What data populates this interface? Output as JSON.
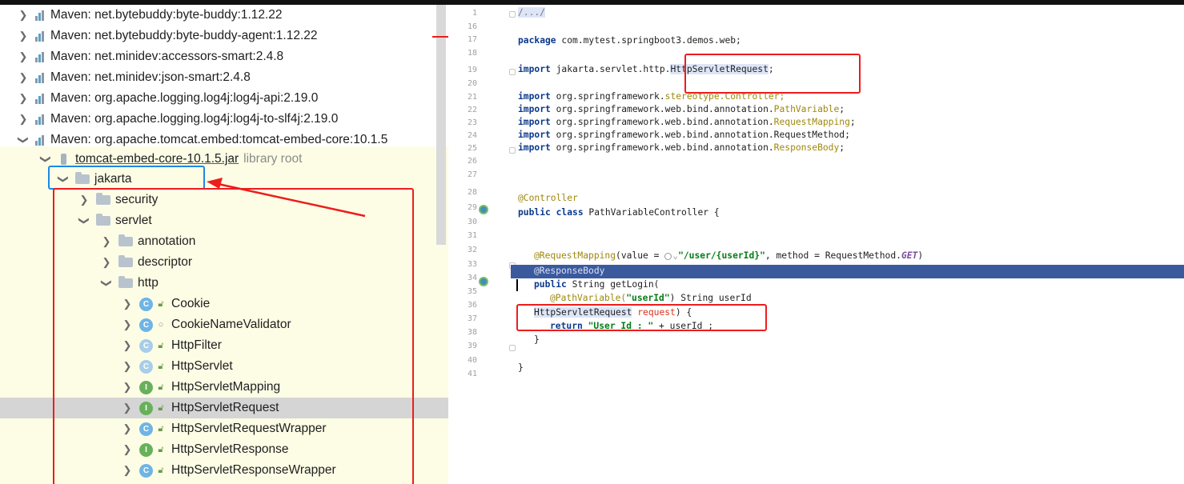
{
  "tree": {
    "libraries": [
      {
        "label": "Maven: net.bytebuddy:byte-buddy:1.12.22"
      },
      {
        "label": "Maven: net.bytebuddy:byte-buddy-agent:1.12.22"
      },
      {
        "label": "Maven: net.minidev:accessors-smart:2.4.8"
      },
      {
        "label": "Maven: net.minidev:json-smart:2.4.8"
      },
      {
        "label": "Maven: org.apache.logging.log4j:log4j-api:2.19.0"
      },
      {
        "label": "Maven: org.apache.logging.log4j:log4j-to-slf4j:2.19.0"
      },
      {
        "label": "Maven: org.apache.tomcat.embed:tomcat-embed-core:10.1.5"
      }
    ],
    "jar": {
      "label": "tomcat-embed-core-10.1.5.jar",
      "suffix": "library root"
    },
    "folders": {
      "jakarta": "jakarta",
      "security": "security",
      "servlet": "servlet",
      "annotation": "annotation",
      "descriptor": "descriptor",
      "http": "http"
    },
    "classes": [
      {
        "label": "Cookie",
        "badge": "C"
      },
      {
        "label": "CookieNameValidator",
        "badge": "C"
      },
      {
        "label": "HttpFilter",
        "badge": "C"
      },
      {
        "label": "HttpServlet",
        "badge": "C"
      },
      {
        "label": "HttpServletMapping",
        "badge": "I"
      },
      {
        "label": "HttpServletRequest",
        "badge": "I"
      },
      {
        "label": "HttpServletRequestWrapper",
        "badge": "C"
      },
      {
        "label": "HttpServletResponse",
        "badge": "I"
      },
      {
        "label": "HttpServletResponseWrapper",
        "badge": "C"
      }
    ]
  },
  "editor": {
    "line_numbers": [
      "1",
      "16",
      "17",
      "18",
      "19",
      "20",
      "21",
      "22",
      "23",
      "24",
      "25",
      "26",
      "27",
      "28",
      "29",
      "30",
      "31",
      "32",
      "33",
      "34",
      "35",
      "36",
      "37",
      "38",
      "39",
      "40",
      "41"
    ],
    "code": {
      "l1": "/.../",
      "pkg_kw": "package",
      "pkg_name": " com.mytest.springboot3.demos.web;",
      "imp_kw": "import",
      "imp19_a": " jakarta.servlet.http.",
      "imp19_b": "HttpServletRequest",
      "imp19_c": ";",
      "imp21_a": " org.springframework.",
      "imp21_b": "stereotype.Controller;",
      "imp22_a": " org.springframework.web.bind.annotation.",
      "imp22_b": "PathVariable",
      "imp23_b": "RequestMapping",
      "imp24_b": "RequestMethod",
      "imp25_b": "ResponseBody",
      "semi": ";",
      "ann_controller": "@Controller",
      "public_class": "public class",
      "class_name": " PathVariableController {",
      "rm_ann": "@RequestMapping",
      "rm_open": "(value = ",
      "rm_str": "\"/user/{userId}\"",
      "rm_method": ", method = RequestMethod.",
      "rm_get": "GET",
      "rm_close": ")",
      "rb_ann": "@ResponseBody",
      "pub_kw": "public",
      "sig": " String getLogin(",
      "pv_ann": "@PathVariable(",
      "pv_str": "\"userId\"",
      "pv_rest": ") String userId",
      "req_type": "HttpServletRequest",
      "req_param": " request",
      "req_close": ") {",
      "ret_kw": "return",
      "ret_str": " \"User Id : \"",
      "ret_rest": " + userId ;",
      "brace_close": "}",
      "class_close": "}"
    }
  },
  "colors": {
    "annotation_red": "#ee1c1c",
    "annotation_blue": "#1e88e5",
    "selected_line": "#3b5a9e",
    "library_bg": "#fdfde6"
  }
}
